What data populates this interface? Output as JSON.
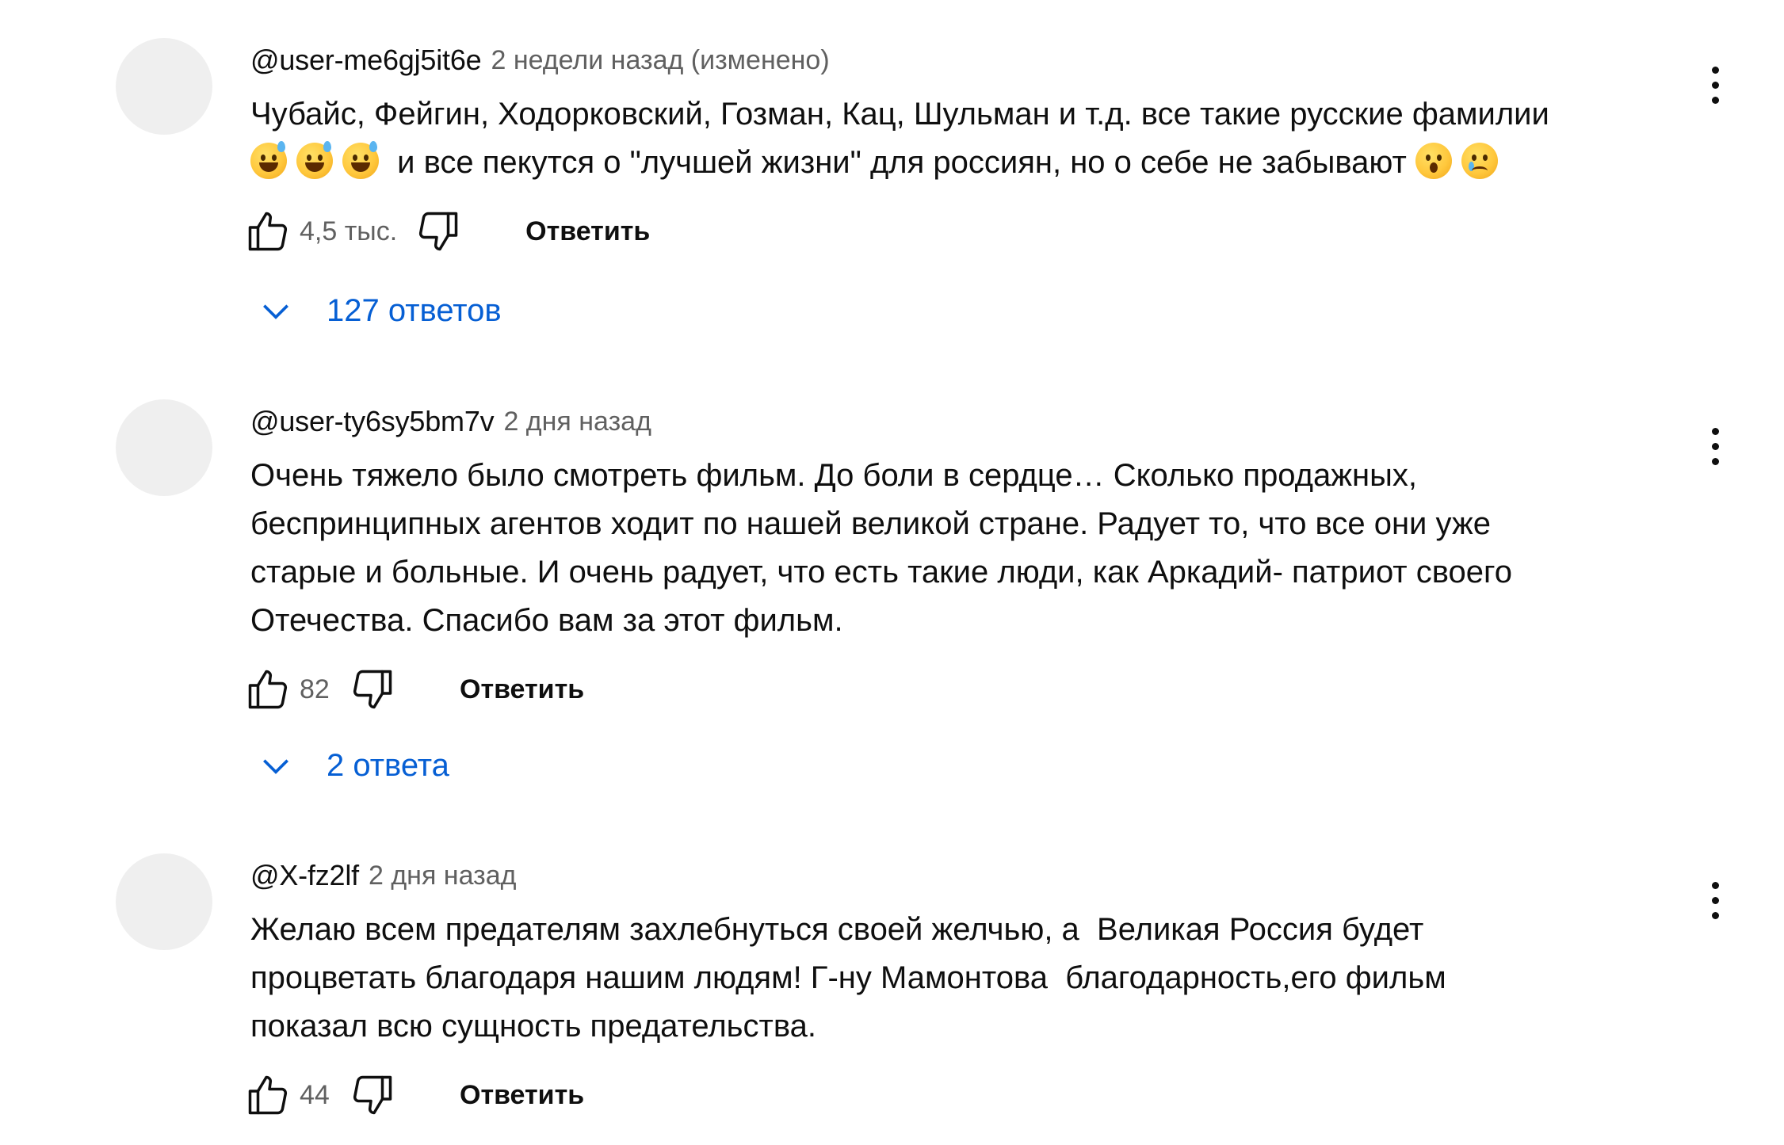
{
  "comments": [
    {
      "author": "@user-me6gj5it6e",
      "time": "2 недели назад (изменено)",
      "text_line1": "Чубайс, Фейгин, Ходорковский, Гозман, Кац, Шульман и т.д. все такие русские фамилии",
      "text_line2": " и все пекутся о \"лучшей жизни\" для россиян, но о себе не забывают ",
      "emojis_line2_before": [
        "grinning-sweat-emoji",
        "grinning-sweat-emoji",
        "grinning-sweat-emoji"
      ],
      "emojis_line2_after": [
        "astonished-emoji",
        "crying-emoji"
      ],
      "likes": "4,5 тыс.",
      "reply_label": "Ответить",
      "replies_label": "127 ответов"
    },
    {
      "author": "@user-ty6sy5bm7v",
      "time": "2 дня назад",
      "text": "Очень тяжело было смотреть фильм. До боли в сердце… Сколько продажных,\nбеспринципных агентов ходит по нашей великой стране. Радует то, что все они уже\nстарые и больные. И очень радует, что есть такие люди, как Аркадий- патриот своего\nОтечества. Спасибо вам за этот фильм.",
      "likes": "82",
      "reply_label": "Ответить",
      "replies_label": "2 ответа"
    },
    {
      "author": "@X-fz2lf",
      "time": "2 дня назад",
      "text": "Желаю всем предателям захлебнуться своей желчью, а  Великая Россия будет\nпроцветать благодаря нашим людям! Г-ну Мамонтова  благодарность,его фильм\nпоказал всю сущность предательства.",
      "likes": "44",
      "reply_label": "Ответить"
    }
  ],
  "colors": {
    "link": "#065fd4",
    "secondary_text": "#606060",
    "avatar_placeholder": "#efefef"
  }
}
